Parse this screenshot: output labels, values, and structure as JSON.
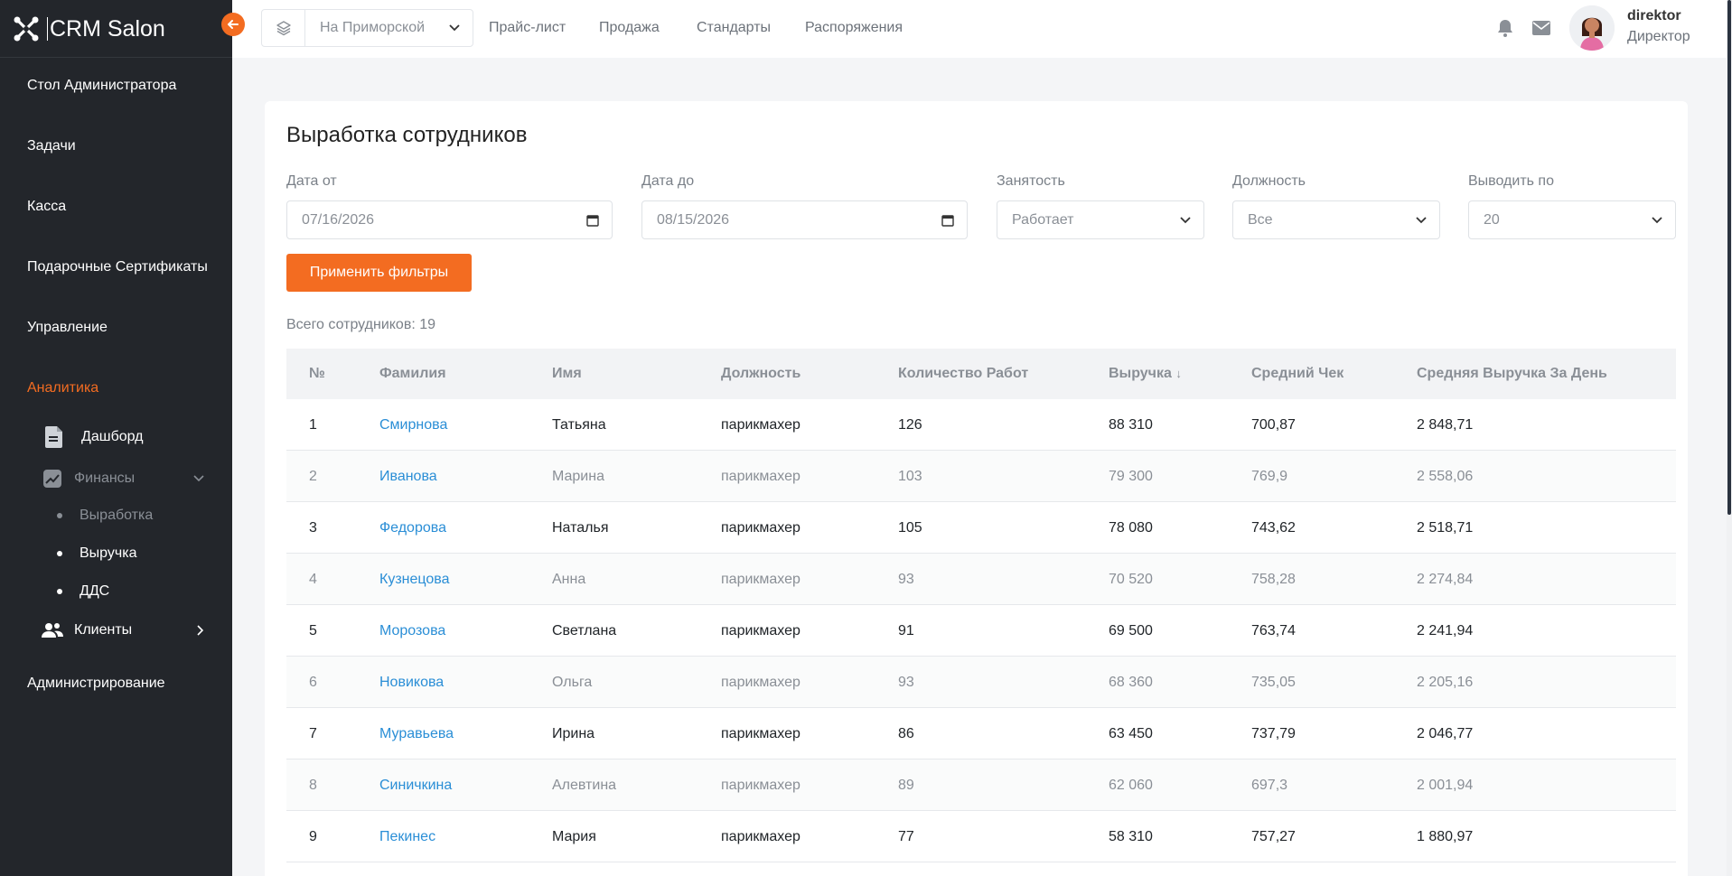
{
  "brand": {
    "name": "CRM Salon",
    "accent": "#f36c21"
  },
  "sidebar": {
    "items": [
      {
        "label": "Стол Администратора"
      },
      {
        "label": "Задачи"
      },
      {
        "label": "Касса"
      },
      {
        "label": "Подарочные Сертификаты"
      },
      {
        "label": "Управление"
      },
      {
        "label": "Аналитика",
        "active": true
      },
      {
        "label": "Администрирование"
      }
    ],
    "analytics_sub": {
      "dashboard": "Дашборд",
      "finance": "Финансы",
      "finance_children": [
        "Выработка",
        "Выручка",
        "ДДС"
      ],
      "clients": "Клиенты"
    }
  },
  "topbar": {
    "branch": "На Приморской",
    "nav": [
      "Прайс-лист",
      "Продажа",
      "Стандарты",
      "Распоряжения"
    ],
    "icons": [
      "bell-icon",
      "envelope-icon"
    ],
    "user": {
      "login": "direktor",
      "role": "Директор"
    }
  },
  "page": {
    "title": "Выработка сотрудников",
    "filters": {
      "date_from": {
        "label": "Дата от",
        "value": "07/16/2026"
      },
      "date_to": {
        "label": "Дата до",
        "value": "08/15/2026"
      },
      "employment": {
        "label": "Занятость",
        "value": "Работает"
      },
      "position": {
        "label": "Должность",
        "value": "Все"
      },
      "per_page": {
        "label": "Выводить по",
        "value": "20"
      }
    },
    "apply_label": "Применить фильтры",
    "total_label": "Всего сотрудников: 19"
  },
  "table": {
    "columns": [
      "№",
      "Фамилия",
      "Имя",
      "Должность",
      "Количество Работ",
      "Выручка",
      "Средний Чек",
      "Средняя Выручка За День"
    ],
    "sort_indicator": "↓",
    "rows": [
      [
        "1",
        "Смирнова",
        "Татьяна",
        "парикмахер",
        "126",
        "88 310",
        "700,87",
        "2 848,71"
      ],
      [
        "2",
        "Иванова",
        "Марина",
        "парикмахер",
        "103",
        "79 300",
        "769,9",
        "2 558,06"
      ],
      [
        "3",
        "Федорова",
        "Наталья",
        "парикмахер",
        "105",
        "78 080",
        "743,62",
        "2 518,71"
      ],
      [
        "4",
        "Кузнецова",
        "Анна",
        "парикмахер",
        "93",
        "70 520",
        "758,28",
        "2 274,84"
      ],
      [
        "5",
        "Морозова",
        "Светлана",
        "парикмахер",
        "91",
        "69 500",
        "763,74",
        "2 241,94"
      ],
      [
        "6",
        "Новикова",
        "Ольга",
        "парикмахер",
        "93",
        "68 360",
        "735,05",
        "2 205,16"
      ],
      [
        "7",
        "Муравьева",
        "Ирина",
        "парикмахер",
        "86",
        "63 450",
        "737,79",
        "2 046,77"
      ],
      [
        "8",
        "Синичкина",
        "Алевтина",
        "парикмахер",
        "89",
        "62 060",
        "697,3",
        "2 001,94"
      ],
      [
        "9",
        "Пекинес",
        "Мария",
        "парикмахер",
        "77",
        "58 310",
        "757,27",
        "1 880,97"
      ]
    ]
  }
}
